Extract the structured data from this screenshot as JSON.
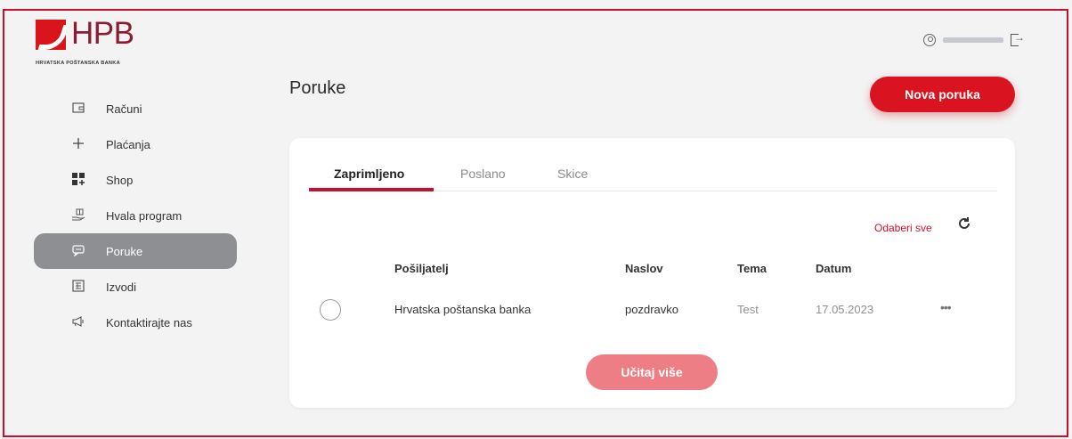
{
  "brand": {
    "name": "HPB",
    "subtitle": "HRVATSKA POŠTANSKA BANKA",
    "accent_color": "#d91420",
    "brand_color": "#8a1d33"
  },
  "header": {
    "user_icon": "user-circle-icon",
    "logout_icon": "logout-icon"
  },
  "sidebar": {
    "items": [
      {
        "label": "Računi",
        "icon": "wallet-icon"
      },
      {
        "label": "Plaćanja",
        "icon": "plus-icon"
      },
      {
        "label": "Shop",
        "icon": "grid-icon"
      },
      {
        "label": "Hvala program",
        "icon": "gift-hand-icon"
      },
      {
        "label": "Poruke",
        "icon": "message-icon",
        "active": true
      },
      {
        "label": "Izvodi",
        "icon": "document-icon"
      },
      {
        "label": "Kontaktirajte nas",
        "icon": "megaphone-icon"
      }
    ]
  },
  "main": {
    "title": "Poruke",
    "new_button": "Nova poruka",
    "tabs": [
      "Zaprimljeno",
      "Poslano",
      "Skice"
    ],
    "active_tab": "Zaprimljeno",
    "select_all": "Odaberi sve",
    "refresh_icon": "refresh-icon",
    "table": {
      "columns": [
        "Pošiljatelj",
        "Naslov",
        "Tema",
        "Datum"
      ],
      "rows": [
        {
          "sender": "Hrvatska poštanska banka",
          "title": "pozdravko",
          "topic": "Test",
          "date": "17.05.2023",
          "more": "•••"
        }
      ]
    },
    "load_more": "Učitaj više"
  }
}
